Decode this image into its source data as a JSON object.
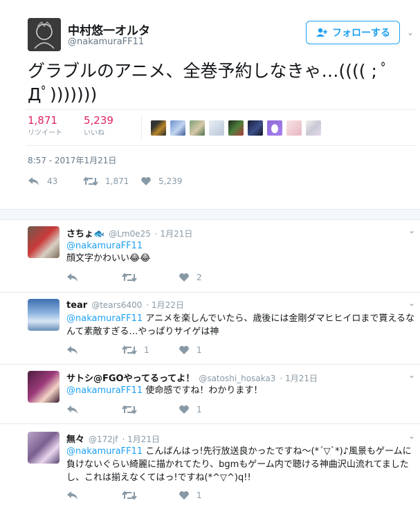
{
  "main": {
    "user": {
      "name": "中村悠一オルタ",
      "handle": "@nakamuraFF11"
    },
    "follow_label": "フォローする",
    "text": "グラブルのアニメ、全巻予約しなきゃ…(((( ; ﾟДﾟ)))))))",
    "retweets": {
      "count": "1,871",
      "label": "リツイート"
    },
    "likes": {
      "count": "5,239",
      "label": "いいね"
    },
    "timestamp": "8:57 - 2017年1月21日",
    "actions": {
      "reply": "43",
      "retweet": "1,871",
      "like": "5,239"
    }
  },
  "replies": [
    {
      "name": "さちょ🐟",
      "handle": "@Lm0e25",
      "date": "· 1月21日",
      "mention": "@nakamuraFF11",
      "text": "顔文字かわいい😂😂",
      "like_count": "2",
      "retweet_count": ""
    },
    {
      "name": "tear",
      "handle": "@tears6400",
      "date": "· 1月22日",
      "mention": "@nakamuraFF11",
      "text": "アニメを楽しんでいたら、歳後には金剛ダマヒヒイロまで貰えるなんて素敵すぎる…やっぱりサイゲは神",
      "like_count": "1",
      "retweet_count": "1"
    },
    {
      "name": "サトシ@FGOやってるってよ！",
      "handle": "@satoshi_hosaka3",
      "date": "· 1月21日",
      "mention": "@nakamuraFF11",
      "text": "使命感ですね！わかります！",
      "like_count": "1",
      "retweet_count": ""
    },
    {
      "name": "無々",
      "handle": "@172jf",
      "date": "· 1月21日",
      "mention": "@nakamuraFF11",
      "text": "こんばんはっ!先行放送良かったですね〜(*´▽`*)♪風景もゲームに負けないぐらい綺麗に描かれてたり、bgmもゲーム内で聴ける神曲沢山流れてましたし、これは揃えなくてはっ!ですね(*^▽^)q!!",
      "like_count": "1",
      "retweet_count": ""
    }
  ],
  "colors": {
    "accent": "#1da1f2",
    "like": "#e0245e",
    "muted": "#8899a6"
  }
}
